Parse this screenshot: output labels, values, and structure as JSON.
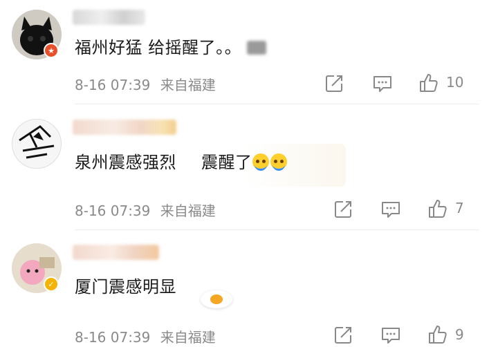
{
  "comments": [
    {
      "text": "福州好猛 给摇醒了。。",
      "time": "8-16 07:39",
      "location": "来自福建",
      "likes": "10",
      "avatar_icon": "black-cat-avatar",
      "badge_icon": "star-badge-icon",
      "badge_color": "#e8502c"
    },
    {
      "text_part1": "泉州震感强烈",
      "text_part2": "震醒了",
      "time": "8-16 07:39",
      "location": "来自福建",
      "likes": "7",
      "avatar_icon": "sketch-avatar"
    },
    {
      "text": "厦门震感明显",
      "time": "8-16 07:39",
      "location": "来自福建",
      "likes": "9",
      "avatar_icon": "pink-character-avatar",
      "badge_icon": "verified-badge-icon",
      "badge_color": "#f4b400"
    }
  ],
  "icons": {
    "share": "share-icon",
    "comment": "comment-icon",
    "like": "thumbs-up-icon"
  }
}
